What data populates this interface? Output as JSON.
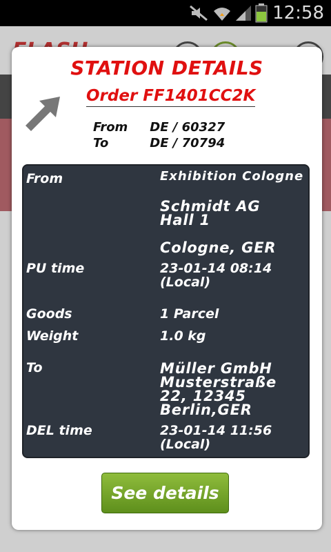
{
  "status_bar": {
    "time": "12:58"
  },
  "background_app": {
    "logo": "FLASH"
  },
  "dialog": {
    "title": "STATION DETAILS",
    "order_label": "Order FF1401CC2K",
    "route": {
      "from_label": "From",
      "from_value": "DE / 60327",
      "to_label": "To",
      "to_value": "DE / 70794"
    },
    "details": {
      "from_label": "From",
      "from_lines": [
        "Exhibition Cologne",
        "Schmidt AG",
        "Hall 1",
        "Cologne, GER"
      ],
      "pu_label": "PU time",
      "pu_lines": [
        "23-01-14 08:14",
        "(Local)"
      ],
      "goods_label": "Goods",
      "goods_value": "1 Parcel",
      "weight_label": "Weight",
      "weight_value": "1.0 kg",
      "to_label": "To",
      "to_lines": [
        "Müller GmbH",
        "Musterstraße",
        "22, 12345",
        "Berlin,GER"
      ],
      "del_label": "DEL time",
      "del_lines": [
        "23-01-14 11:56",
        "(Local)"
      ]
    },
    "button_label": "See details"
  }
}
